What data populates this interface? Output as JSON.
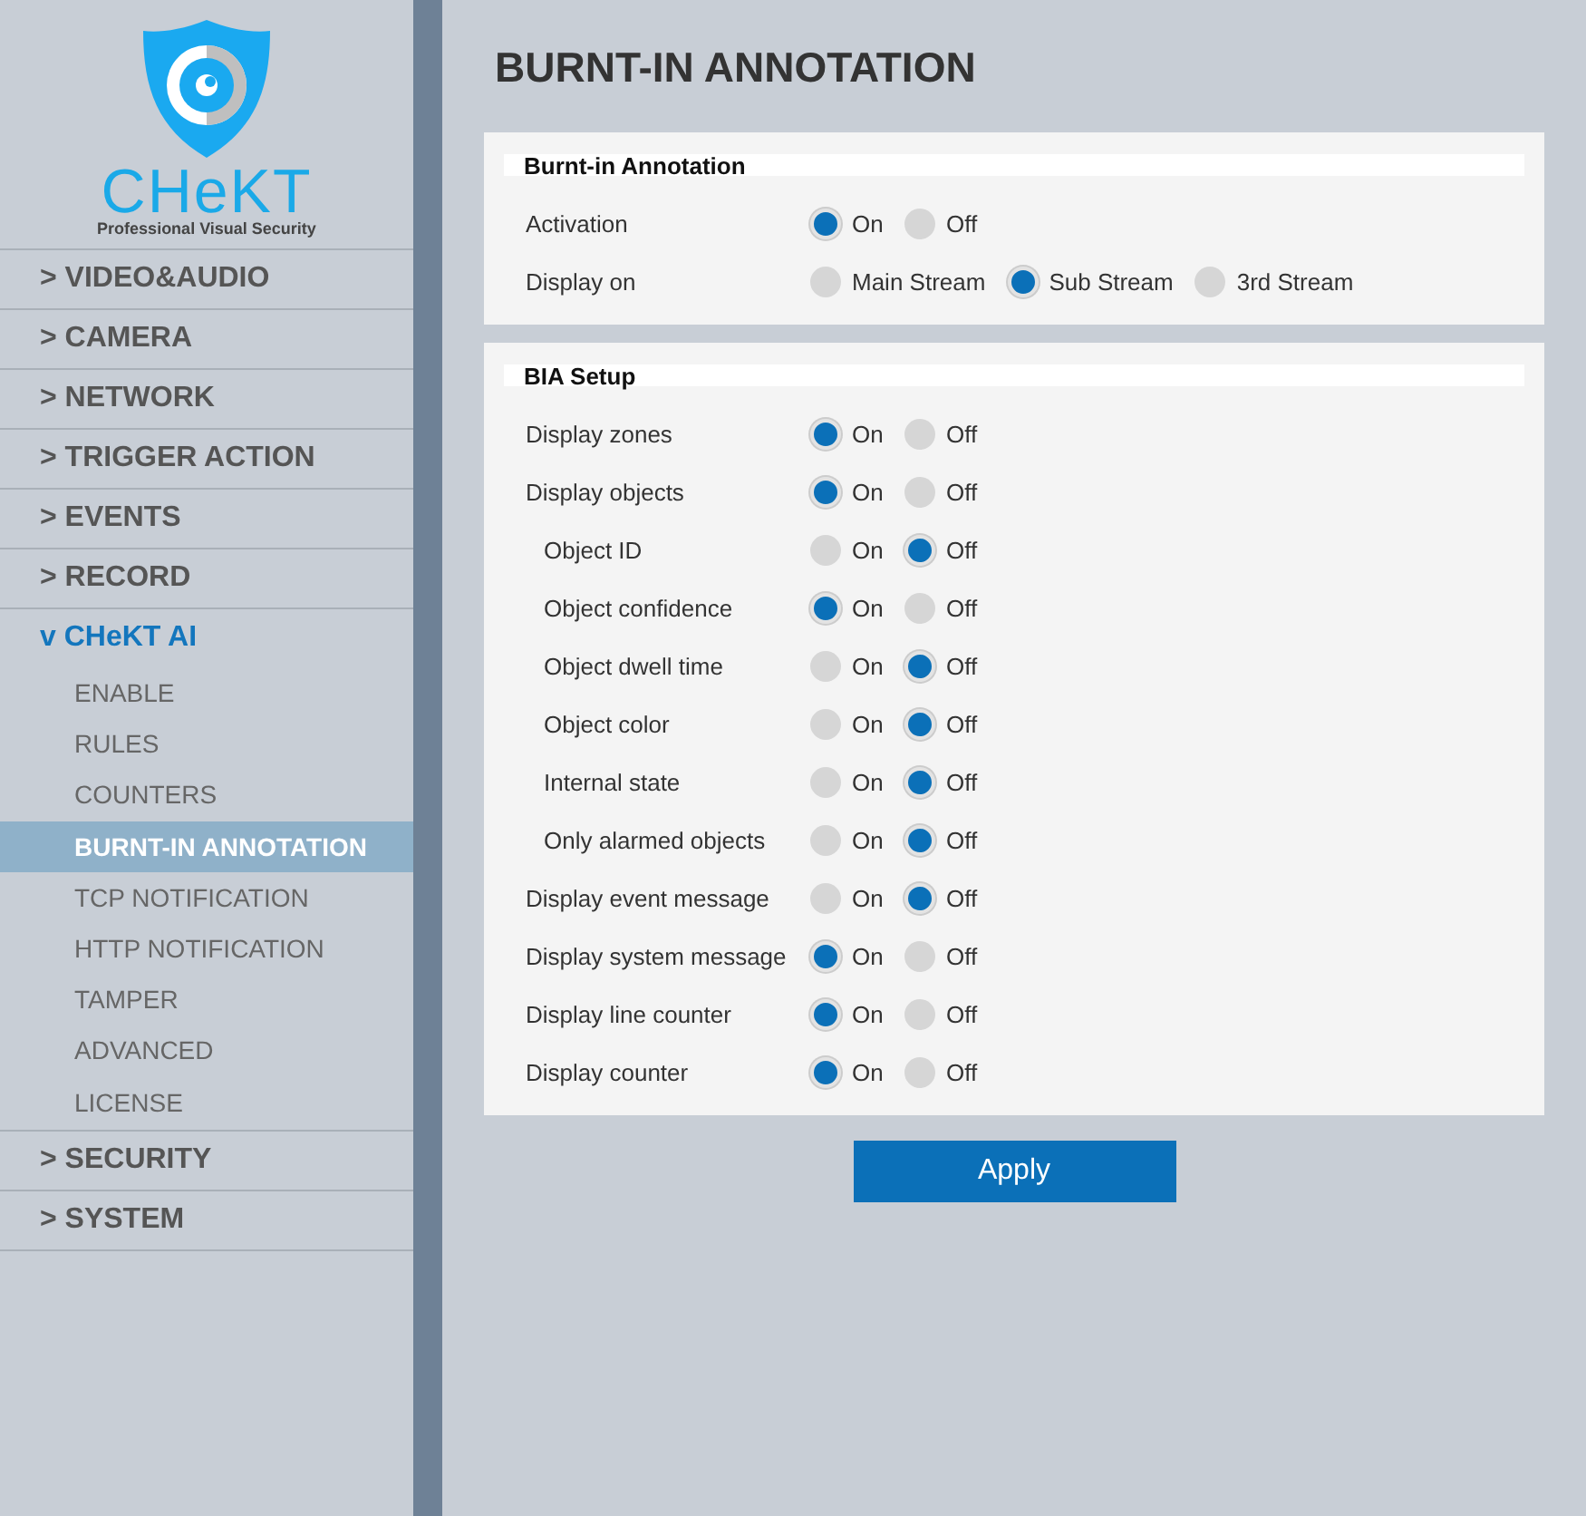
{
  "sidebar": {
    "logo": {
      "name": "CHeKT",
      "tagline": "Professional Visual Security"
    },
    "menu": [
      {
        "label": "> VIDEO&AUDIO",
        "expanded": false
      },
      {
        "label": "> CAMERA",
        "expanded": false
      },
      {
        "label": "> NETWORK",
        "expanded": false
      },
      {
        "label": "> TRIGGER ACTION",
        "expanded": false
      },
      {
        "label": "> EVENTS",
        "expanded": false
      },
      {
        "label": "> RECORD",
        "expanded": false
      },
      {
        "label": "v CHeKT AI",
        "expanded": true,
        "children": [
          {
            "label": "ENABLE",
            "selected": false
          },
          {
            "label": "RULES",
            "selected": false
          },
          {
            "label": "COUNTERS",
            "selected": false
          },
          {
            "label": "BURNT-IN ANNOTATION",
            "selected": true
          },
          {
            "label": "TCP NOTIFICATION",
            "selected": false
          },
          {
            "label": "HTTP NOTIFICATION",
            "selected": false
          },
          {
            "label": "TAMPER",
            "selected": false
          },
          {
            "label": "ADVANCED",
            "selected": false
          },
          {
            "label": "LICENSE",
            "selected": false
          }
        ]
      },
      {
        "label": "> SECURITY",
        "expanded": false
      },
      {
        "label": "> SYSTEM",
        "expanded": false
      }
    ]
  },
  "page_title": "BURNT-IN ANNOTATION",
  "sections": [
    {
      "title": "Burnt-in Annotation",
      "rows": [
        {
          "label": "Activation",
          "kind": "main",
          "options": [
            {
              "label": "On",
              "selected": true
            },
            {
              "label": "Off",
              "selected": false
            }
          ]
        },
        {
          "label": "Display on",
          "kind": "main",
          "options": [
            {
              "label": "Main Stream",
              "selected": false
            },
            {
              "label": "Sub Stream",
              "selected": true
            },
            {
              "label": "3rd Stream",
              "selected": false
            }
          ]
        }
      ]
    },
    {
      "title": "BIA Setup",
      "rows": [
        {
          "label": "Display zones",
          "kind": "main",
          "options": [
            {
              "label": "On",
              "selected": true
            },
            {
              "label": "Off",
              "selected": false
            }
          ]
        },
        {
          "label": "Display objects",
          "kind": "main",
          "options": [
            {
              "label": "On",
              "selected": true
            },
            {
              "label": "Off",
              "selected": false
            }
          ]
        },
        {
          "label": "Object ID",
          "kind": "sub",
          "options": [
            {
              "label": "On",
              "selected": false
            },
            {
              "label": "Off",
              "selected": true
            }
          ]
        },
        {
          "label": "Object confidence",
          "kind": "sub",
          "options": [
            {
              "label": "On",
              "selected": true
            },
            {
              "label": "Off",
              "selected": false
            }
          ]
        },
        {
          "label": "Object dwell time",
          "kind": "sub",
          "options": [
            {
              "label": "On",
              "selected": false
            },
            {
              "label": "Off",
              "selected": true
            }
          ]
        },
        {
          "label": "Object color",
          "kind": "sub",
          "options": [
            {
              "label": "On",
              "selected": false
            },
            {
              "label": "Off",
              "selected": true
            }
          ]
        },
        {
          "label": "Internal state",
          "kind": "sub",
          "options": [
            {
              "label": "On",
              "selected": false
            },
            {
              "label": "Off",
              "selected": true
            }
          ]
        },
        {
          "label": "Only alarmed objects",
          "kind": "sub",
          "options": [
            {
              "label": "On",
              "selected": false
            },
            {
              "label": "Off",
              "selected": true
            }
          ]
        },
        {
          "label": "Display event message",
          "kind": "main",
          "options": [
            {
              "label": "On",
              "selected": false
            },
            {
              "label": "Off",
              "selected": true
            }
          ]
        },
        {
          "label": "Display system message",
          "kind": "main",
          "options": [
            {
              "label": "On",
              "selected": true
            },
            {
              "label": "Off",
              "selected": false
            }
          ]
        },
        {
          "label": "Display line counter",
          "kind": "main",
          "options": [
            {
              "label": "On",
              "selected": true
            },
            {
              "label": "Off",
              "selected": false
            }
          ]
        },
        {
          "label": "Display counter",
          "kind": "main",
          "options": [
            {
              "label": "On",
              "selected": true
            },
            {
              "label": "Off",
              "selected": false
            }
          ]
        }
      ]
    }
  ],
  "apply_button": "Apply"
}
